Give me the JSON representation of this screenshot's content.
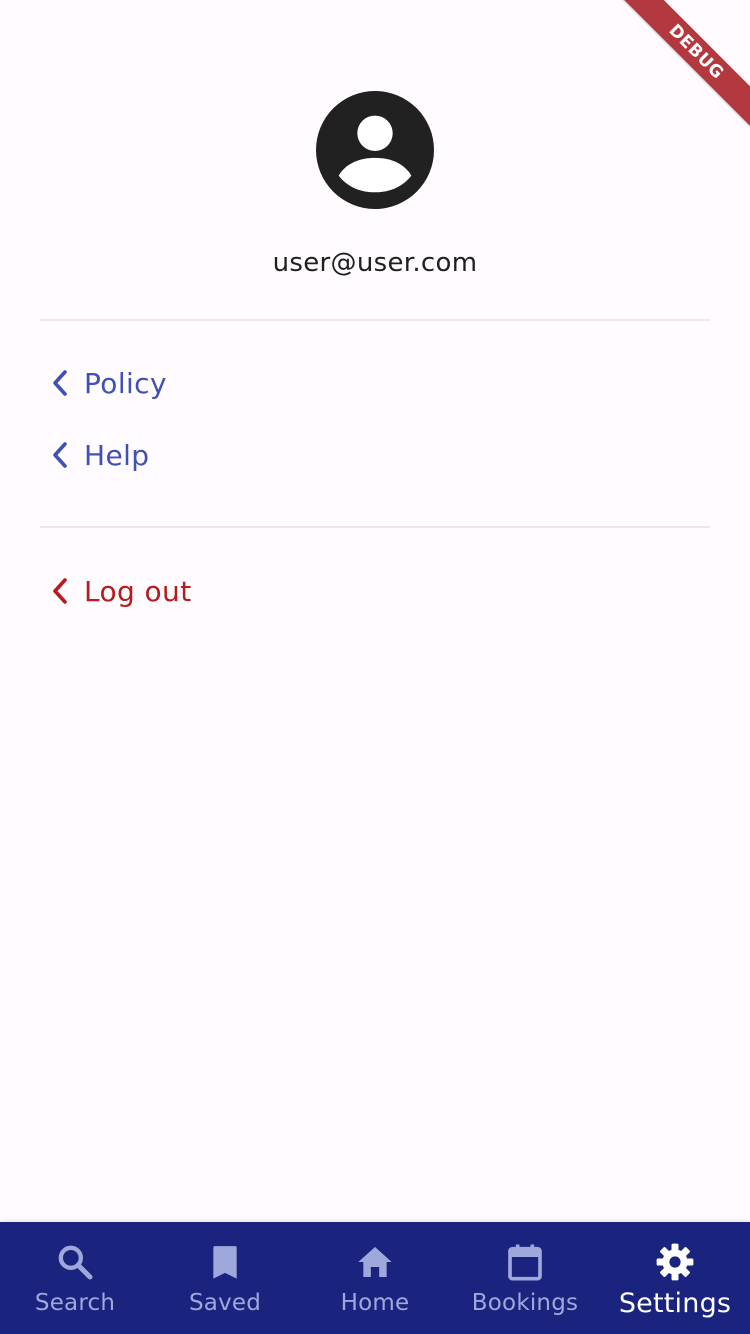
{
  "profile": {
    "email": "user@user.com",
    "avatar_icon": "account-circle-icon"
  },
  "menu": {
    "items": [
      {
        "label": "Policy",
        "icon": "chevron-left-icon",
        "color": "#3f51b5"
      },
      {
        "label": "Help",
        "icon": "chevron-left-icon",
        "color": "#3f51b5"
      }
    ],
    "logout": {
      "label": "Log out",
      "icon": "chevron-left-icon",
      "color": "#b71c1c"
    }
  },
  "debug_banner": {
    "label": "DEBUG",
    "color": "#b3393f"
  },
  "bottom_nav": {
    "background": "#1a237e",
    "inactive_color": "#9fa8da",
    "active_color": "#ffffff",
    "active_index": 4,
    "items": [
      {
        "label": "Search",
        "icon": "search-icon"
      },
      {
        "label": "Saved",
        "icon": "bookmark-icon"
      },
      {
        "label": "Home",
        "icon": "home-icon"
      },
      {
        "label": "Bookings",
        "icon": "calendar-icon"
      },
      {
        "label": "Settings",
        "icon": "gear-icon"
      }
    ]
  }
}
